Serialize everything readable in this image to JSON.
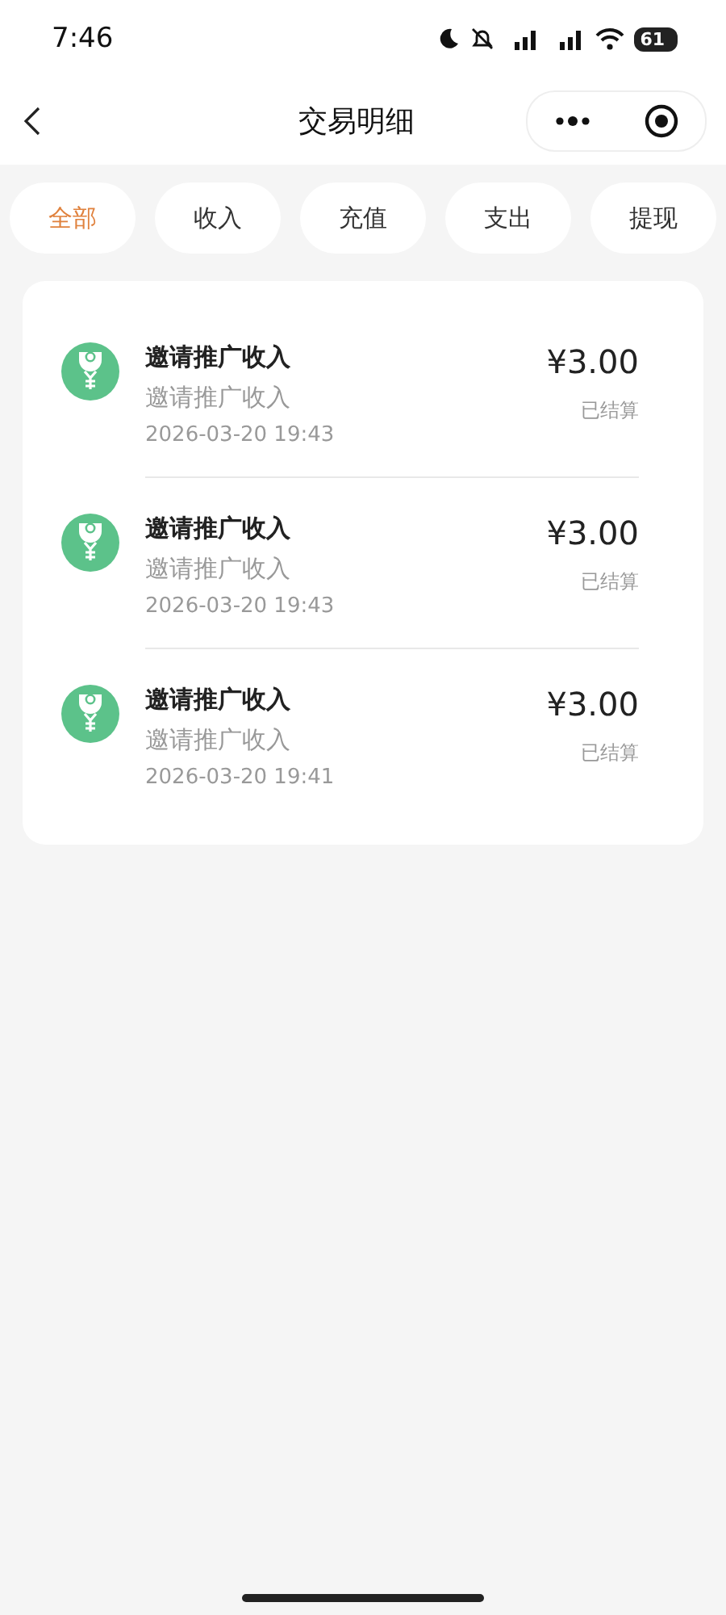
{
  "status_bar": {
    "time": "7:46",
    "battery": "61"
  },
  "nav": {
    "title": "交易明细"
  },
  "tabs": [
    {
      "label": "全部",
      "selected": true
    },
    {
      "label": "收入",
      "selected": false
    },
    {
      "label": "充值",
      "selected": false
    },
    {
      "label": "支出",
      "selected": false
    },
    {
      "label": "提现",
      "selected": false
    }
  ],
  "transactions": [
    {
      "title": "邀请推广收入",
      "subtitle": "邀请推广收入",
      "time": "2026-03-20 19:43",
      "amount": "¥3.00",
      "status": "已结算"
    },
    {
      "title": "邀请推广收入",
      "subtitle": "邀请推广收入",
      "time": "2026-03-20 19:43",
      "amount": "¥3.00",
      "status": "已结算"
    },
    {
      "title": "邀请推广收入",
      "subtitle": "邀请推广收入",
      "time": "2026-03-20 19:41",
      "amount": "¥3.00",
      "status": "已结算"
    }
  ]
}
